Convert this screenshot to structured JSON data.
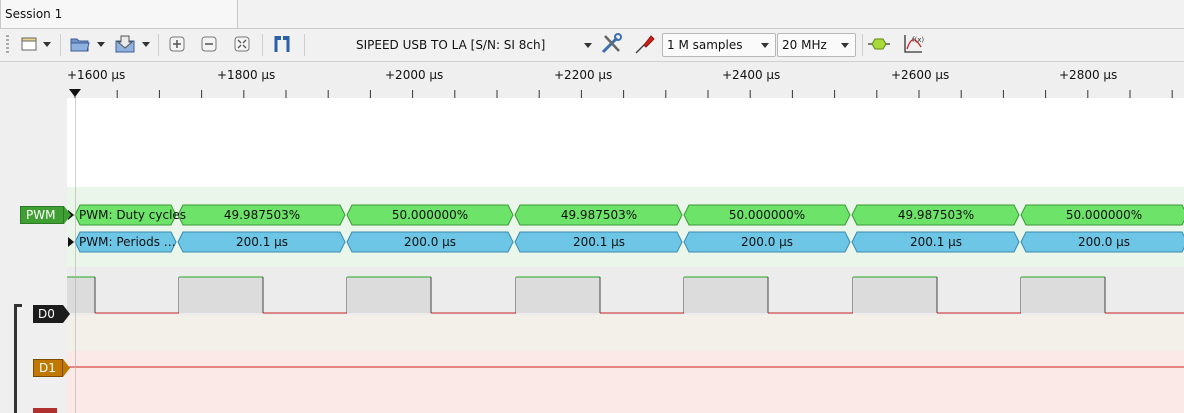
{
  "session_tab": "Session 1",
  "device": "SIPEED USB TO LA [S/N: SI 8ch]",
  "samples": "1 M samples",
  "samplerate": "20 MHz",
  "ruler_labels": [
    "+1600 μs",
    "+1800 μs",
    "+2000 μs",
    "+2200 μs",
    "+2400 μs",
    "+2600 μs",
    "+2800 μs"
  ],
  "decoder": {
    "name": "PWM",
    "rows": [
      {
        "label": "PWM: Duty cycles",
        "values": [
          "49.987503%",
          "50.000000%",
          "49.987503%",
          "50.000000%",
          "49.987503%",
          "50.000000%"
        ]
      },
      {
        "label": "PWM: Periods …",
        "values": [
          "200.1 μs",
          "200.0 μs",
          "200.1 μs",
          "200.0 μs",
          "200.1 μs",
          "200.0 μs"
        ]
      }
    ]
  },
  "channels": [
    {
      "name": "D0"
    },
    {
      "name": "D1"
    }
  ],
  "colors": {
    "duty_fill": "#6ee36a",
    "period_fill": "#6ec6e6",
    "pwm_label": "#3f9f33",
    "d0_label": "#1c1c1c",
    "d1_label": "#c07800",
    "high_line": "#22aa22",
    "low_line": "#cc2222"
  },
  "icons": {
    "new_session": "new-document-icon",
    "open": "folder-open-icon",
    "save": "save-icon",
    "zoom_in": "zoom-in-icon",
    "zoom_out": "zoom-out-icon",
    "zoom_fit": "zoom-fit-icon",
    "cursors": "cursor-pair-icon",
    "config": "wrench-screwdriver-icon",
    "probe": "probe-icon",
    "add_decoder": "add-decoder-icon",
    "math": "math-channel-icon"
  }
}
